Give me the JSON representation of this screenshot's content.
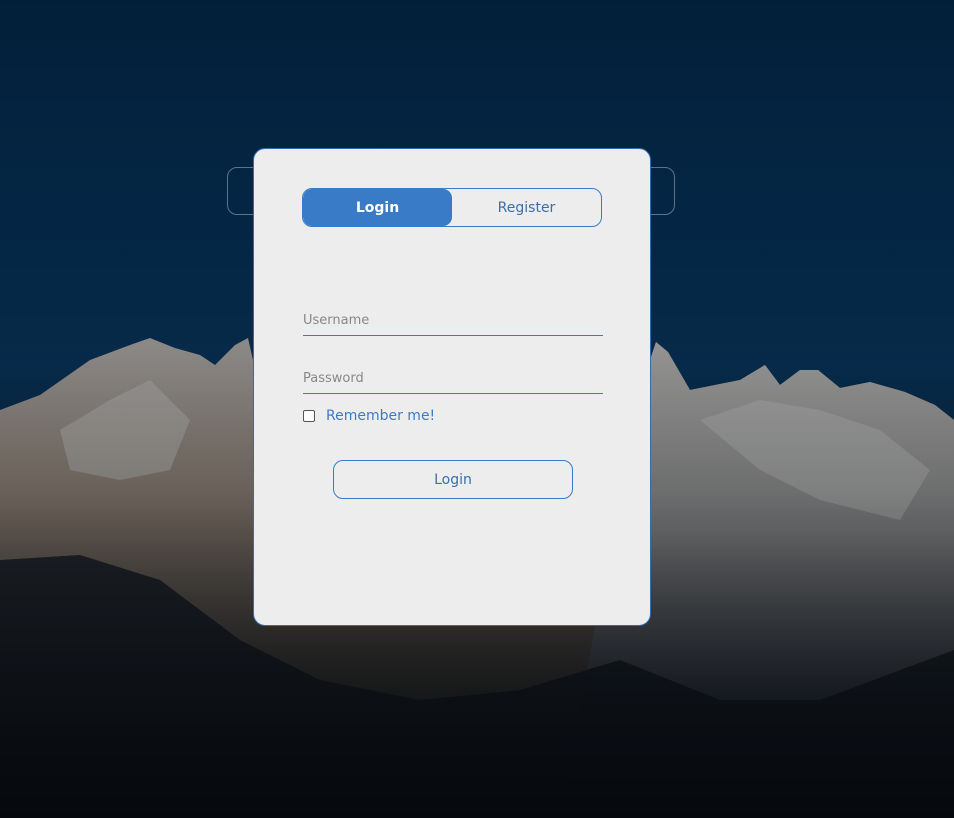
{
  "background": {
    "sky_top": "#032440",
    "sky_mid": "#0a3c66"
  },
  "tabs": [
    {
      "label": "Login",
      "active": true
    },
    {
      "label": "Register",
      "active": false
    }
  ],
  "form": {
    "username_placeholder": "Username",
    "username_value": "",
    "password_placeholder": "Password",
    "password_value": "",
    "remember_label": "Remember me!",
    "remember_checked": false,
    "submit_label": "Login"
  },
  "colors": {
    "accent": "#3a7bc8",
    "card_bg": "#ededed"
  }
}
